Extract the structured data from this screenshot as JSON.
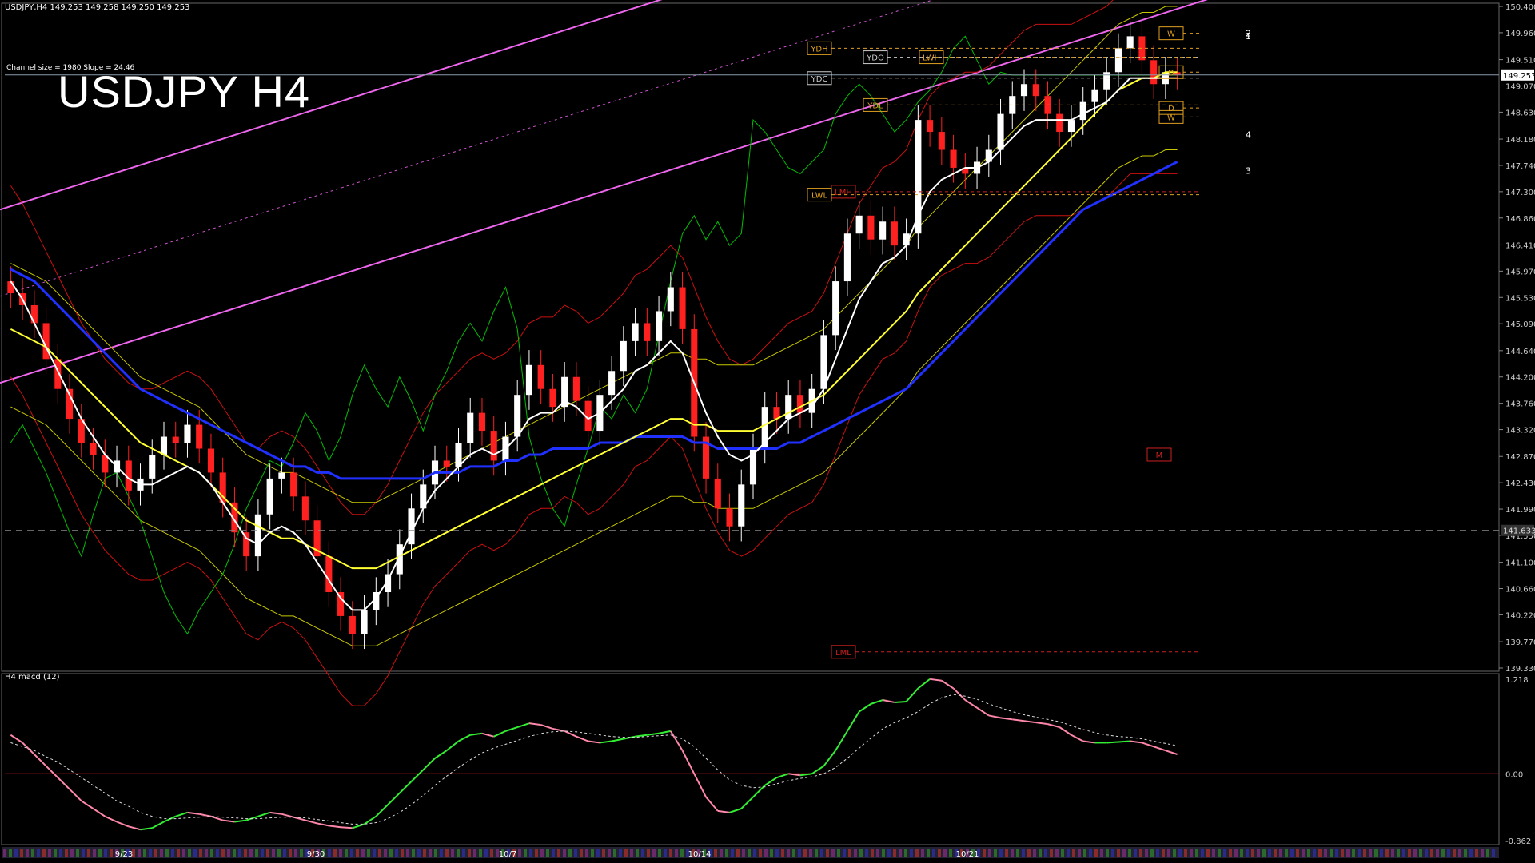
{
  "header": {
    "symbol_line": "USDJPY,H4  149.253 149.258 149.250 149.253",
    "channel_info": "Channel size = 1980 Slope = 24.46",
    "big_title": "USDJPY H4",
    "macd_label": "H4  macd (12)"
  },
  "colors": {
    "background": "#000000",
    "bull": "#ffffff",
    "bear": "#ff2020",
    "ma_white": "#ffffff",
    "ma_yellow": "#ffff33",
    "ma_blue": "#2030ff",
    "band_red": "#cc1010",
    "band_yellow": "#c8c800",
    "ichimoku_green": "#00c000",
    "channel": "#ee66ee",
    "macd_up": "#33ee33",
    "macd_down": "#ff88aa"
  },
  "chart_data": [
    {
      "type": "candlestick",
      "symbol": "USDJPY",
      "timeframe": "H4",
      "ylim": [
        139.33,
        150.4
      ],
      "y_ticks": [
        "150.400",
        "149.960",
        "149.510",
        "149.070",
        "148.630",
        "148.180",
        "147.740",
        "147.300",
        "146.860",
        "146.410",
        "145.970",
        "145.530",
        "145.090",
        "144.640",
        "144.200",
        "143.760",
        "143.320",
        "142.870",
        "142.430",
        "141.990",
        "141.550",
        "141.100",
        "140.660",
        "140.220",
        "139.770",
        "139.330"
      ],
      "current_price": "149.253",
      "ref_price": "141.633",
      "x_labels": [
        "9/23",
        "9/30",
        "10/7",
        "10/14",
        "10/21"
      ],
      "close": [
        145.6,
        145.4,
        145.1,
        144.5,
        144.0,
        143.5,
        143.1,
        142.9,
        142.6,
        142.8,
        142.3,
        142.5,
        142.9,
        143.2,
        143.1,
        143.4,
        143.0,
        142.6,
        142.1,
        141.6,
        141.2,
        141.9,
        142.5,
        142.6,
        142.2,
        141.8,
        141.2,
        140.6,
        140.2,
        139.9,
        140.3,
        140.6,
        140.9,
        141.4,
        142.0,
        142.4,
        142.8,
        142.7,
        143.1,
        143.6,
        143.3,
        142.8,
        143.2,
        143.9,
        144.4,
        144.0,
        143.7,
        144.2,
        143.8,
        143.3,
        143.9,
        144.3,
        144.8,
        145.1,
        144.8,
        145.3,
        145.7,
        145.0,
        143.2,
        142.5,
        142.0,
        141.7,
        142.4,
        143.0,
        143.7,
        143.5,
        143.9,
        143.6,
        144.0,
        144.9,
        145.8,
        146.6,
        146.9,
        146.5,
        146.8,
        146.4,
        146.6,
        148.5,
        148.3,
        148.0,
        147.7,
        147.6,
        147.8,
        148.0,
        148.6,
        148.9,
        149.1,
        148.9,
        148.6,
        148.3,
        148.5,
        148.8,
        149.0,
        149.3,
        149.7,
        149.9,
        149.5,
        149.1,
        149.3,
        149.25
      ],
      "ma_white": [
        145.8,
        145.5,
        145.1,
        144.7,
        144.3,
        143.9,
        143.5,
        143.2,
        142.9,
        142.7,
        142.5,
        142.4,
        142.4,
        142.5,
        142.6,
        142.7,
        142.6,
        142.4,
        142.1,
        141.8,
        141.5,
        141.4,
        141.6,
        141.7,
        141.6,
        141.4,
        141.1,
        140.8,
        140.5,
        140.3,
        140.3,
        140.5,
        140.8,
        141.2,
        141.6,
        142.0,
        142.3,
        142.5,
        142.7,
        142.9,
        143.0,
        142.9,
        143.0,
        143.2,
        143.5,
        143.6,
        143.6,
        143.8,
        143.7,
        143.5,
        143.6,
        143.8,
        144.0,
        144.3,
        144.4,
        144.6,
        144.8,
        144.6,
        144.1,
        143.6,
        143.2,
        142.9,
        142.8,
        142.9,
        143.1,
        143.3,
        143.5,
        143.6,
        143.7,
        144.0,
        144.5,
        145.0,
        145.5,
        145.8,
        146.1,
        146.2,
        146.4,
        146.9,
        147.3,
        147.5,
        147.6,
        147.7,
        147.7,
        147.8,
        148.0,
        148.2,
        148.4,
        148.5,
        148.5,
        148.5,
        148.5,
        148.6,
        148.7,
        148.8,
        149.0,
        149.2,
        149.2,
        149.2,
        149.2,
        149.2
      ],
      "ma_yellow": [
        145.0,
        144.9,
        144.8,
        144.7,
        144.5,
        144.3,
        144.1,
        143.9,
        143.7,
        143.5,
        143.3,
        143.1,
        143.0,
        142.9,
        142.8,
        142.7,
        142.6,
        142.4,
        142.2,
        142.0,
        141.8,
        141.7,
        141.6,
        141.5,
        141.5,
        141.4,
        141.3,
        141.2,
        141.1,
        141.0,
        141.0,
        141.0,
        141.1,
        141.2,
        141.3,
        141.4,
        141.5,
        141.6,
        141.7,
        141.8,
        141.9,
        142.0,
        142.1,
        142.2,
        142.3,
        142.4,
        142.5,
        142.6,
        142.7,
        142.8,
        142.9,
        143.0,
        143.1,
        143.2,
        143.3,
        143.4,
        143.5,
        143.5,
        143.4,
        143.4,
        143.3,
        143.3,
        143.3,
        143.3,
        143.4,
        143.5,
        143.6,
        143.7,
        143.8,
        143.9,
        144.1,
        144.3,
        144.5,
        144.7,
        144.9,
        145.1,
        145.3,
        145.6,
        145.8,
        146.0,
        146.2,
        146.4,
        146.6,
        146.8,
        147.0,
        147.2,
        147.4,
        147.6,
        147.8,
        148.0,
        148.2,
        148.4,
        148.6,
        148.8,
        149.0,
        149.1,
        149.2,
        149.2,
        149.3,
        149.3
      ],
      "ma_blue": [
        146.0,
        145.9,
        145.8,
        145.6,
        145.4,
        145.2,
        145.0,
        144.8,
        144.6,
        144.4,
        144.2,
        144.0,
        143.9,
        143.8,
        143.7,
        143.6,
        143.5,
        143.4,
        143.3,
        143.2,
        143.1,
        143.0,
        142.9,
        142.8,
        142.7,
        142.7,
        142.6,
        142.6,
        142.5,
        142.5,
        142.5,
        142.5,
        142.5,
        142.5,
        142.5,
        142.5,
        142.6,
        142.6,
        142.6,
        142.7,
        142.7,
        142.7,
        142.8,
        142.8,
        142.9,
        142.9,
        143.0,
        143.0,
        143.0,
        143.0,
        143.1,
        143.1,
        143.1,
        143.2,
        143.2,
        143.2,
        143.2,
        143.2,
        143.1,
        143.1,
        143.0,
        143.0,
        143.0,
        143.0,
        143.0,
        143.0,
        143.1,
        143.1,
        143.2,
        143.3,
        143.4,
        143.5,
        143.6,
        143.7,
        143.8,
        143.9,
        144.0,
        144.2,
        144.4,
        144.6,
        144.8,
        145.0,
        145.2,
        145.4,
        145.6,
        145.8,
        146.0,
        146.2,
        146.4,
        146.6,
        146.8,
        147.0,
        147.1,
        147.2,
        147.3,
        147.4,
        147.5,
        147.6,
        147.7,
        147.8
      ],
      "markers": [
        {
          "label": "YDH",
          "price": 149.7
        },
        {
          "label": "YDO",
          "price": 149.55
        },
        {
          "label": "LWH",
          "price": 149.55
        },
        {
          "label": "YDC",
          "price": 149.2
        },
        {
          "label": "YDL",
          "price": 148.75
        },
        {
          "label": "LMH",
          "price": 147.3
        },
        {
          "label": "LWL",
          "price": 147.25
        },
        {
          "label": "LML",
          "price": 139.6
        },
        {
          "label": "M",
          "price": 142.9
        },
        {
          "label": "W",
          "price": 149.95
        },
        {
          "label": "W",
          "price": 148.55
        },
        {
          "label": "D",
          "price": 149.3
        },
        {
          "label": "D",
          "price": 148.7
        }
      ],
      "projection_labels": [
        "2",
        "1",
        "4",
        "3"
      ]
    },
    {
      "type": "line",
      "name": "macd (12)",
      "ylim": [
        -0.862,
        1.218
      ],
      "y_ticks": [
        "1.218",
        "0.00",
        "-0.862"
      ],
      "macd": [
        0.5,
        0.4,
        0.25,
        0.1,
        -0.05,
        -0.2,
        -0.35,
        -0.45,
        -0.55,
        -0.62,
        -0.68,
        -0.72,
        -0.7,
        -0.62,
        -0.55,
        -0.5,
        -0.52,
        -0.55,
        -0.6,
        -0.62,
        -0.6,
        -0.55,
        -0.5,
        -0.52,
        -0.56,
        -0.6,
        -0.64,
        -0.67,
        -0.69,
        -0.7,
        -0.65,
        -0.55,
        -0.4,
        -0.25,
        -0.1,
        0.05,
        0.2,
        0.3,
        0.42,
        0.5,
        0.52,
        0.48,
        0.55,
        0.6,
        0.65,
        0.63,
        0.58,
        0.55,
        0.48,
        0.42,
        0.4,
        0.42,
        0.45,
        0.48,
        0.5,
        0.52,
        0.55,
        0.3,
        0.0,
        -0.3,
        -0.48,
        -0.5,
        -0.45,
        -0.3,
        -0.15,
        -0.05,
        0.0,
        -0.02,
        0.0,
        0.1,
        0.3,
        0.55,
        0.8,
        0.9,
        0.95,
        0.92,
        0.93,
        1.1,
        1.22,
        1.2,
        1.1,
        0.95,
        0.85,
        0.75,
        0.72,
        0.7,
        0.68,
        0.66,
        0.64,
        0.6,
        0.5,
        0.42,
        0.4,
        0.4,
        0.41,
        0.42,
        0.4,
        0.35,
        0.3,
        0.25
      ],
      "signal": [
        0.4,
        0.35,
        0.3,
        0.22,
        0.15,
        0.05,
        -0.05,
        -0.15,
        -0.25,
        -0.35,
        -0.42,
        -0.5,
        -0.55,
        -0.58,
        -0.58,
        -0.57,
        -0.56,
        -0.55,
        -0.56,
        -0.57,
        -0.58,
        -0.58,
        -0.57,
        -0.56,
        -0.56,
        -0.57,
        -0.59,
        -0.61,
        -0.63,
        -0.65,
        -0.65,
        -0.63,
        -0.58,
        -0.5,
        -0.4,
        -0.28,
        -0.15,
        -0.03,
        0.08,
        0.18,
        0.27,
        0.33,
        0.38,
        0.43,
        0.48,
        0.52,
        0.54,
        0.55,
        0.54,
        0.52,
        0.5,
        0.48,
        0.47,
        0.47,
        0.48,
        0.49,
        0.5,
        0.45,
        0.35,
        0.2,
        0.05,
        -0.08,
        -0.15,
        -0.18,
        -0.17,
        -0.13,
        -0.09,
        -0.06,
        -0.04,
        0.0,
        0.08,
        0.2,
        0.33,
        0.46,
        0.58,
        0.66,
        0.72,
        0.8,
        0.9,
        0.98,
        1.02,
        1.0,
        0.96,
        0.9,
        0.85,
        0.8,
        0.76,
        0.73,
        0.7,
        0.67,
        0.62,
        0.57,
        0.53,
        0.5,
        0.48,
        0.47,
        0.45,
        0.42,
        0.39,
        0.36
      ]
    }
  ]
}
